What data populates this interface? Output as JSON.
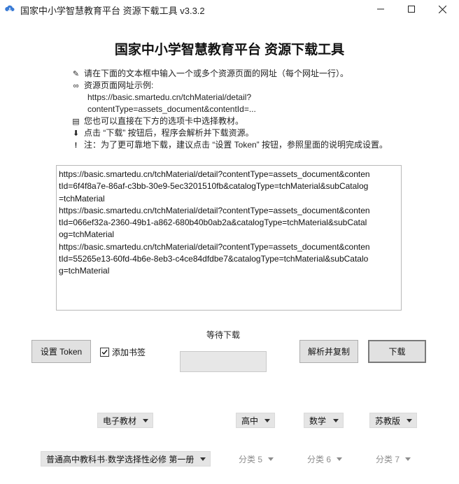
{
  "window": {
    "title": "国家中小学智慧教育平台 资源下载工具 v3.3.2",
    "icon": "download-cloud-icon",
    "controls": [
      "minimize-icon",
      "maximize-icon",
      "close-icon"
    ]
  },
  "heading": "国家中小学智慧教育平台 资源下载工具",
  "instructions": [
    {
      "icon": "pin-icon",
      "text": "请在下面的文本框中输入一个或多个资源页面的网址（每个网址一行）。"
    },
    {
      "icon": "link-icon",
      "text": "资源页面网址示例:"
    },
    {
      "icon": "",
      "text": "https://basic.smartedu.cn/tchMaterial/detail?"
    },
    {
      "icon": "",
      "text": "contentType=assets_document&contentId=..."
    },
    {
      "icon": "memo-icon",
      "text": "您也可以直接在下方的选项卡中选择教材。"
    },
    {
      "icon": "inbox-icon",
      "text": "点击 “下载” 按钮后，程序会解析并下载资源。"
    },
    {
      "icon": "exclamation-icon",
      "text": "注：为了更可靠地下载，建议点击 “设置 Token” 按钮，参照里面的说明完成设置。"
    }
  ],
  "url_input": {
    "lines": [
      "https://basic.smartedu.cn/tchMaterial/detail?contentType=assets_document&conten",
      "tId=6f4f8a7e-86af-c3bb-30e9-5ec3201510fb&catalogType=tchMaterial&subCatalog",
      "=tchMaterial",
      "https://basic.smartedu.cn/tchMaterial/detail?contentType=assets_document&conten",
      "tId=066ef32a-2360-49b1-a862-680b40b0ab2a&catalogType=tchMaterial&subCatal",
      "og=tchMaterial",
      "https://basic.smartedu.cn/tchMaterial/detail?contentType=assets_document&conten",
      "tId=55265e13-60fd-4b6e-8eb3-c4ce84dfdbe7&catalogType=tchMaterial&subCatalo",
      "g=tchMaterial"
    ]
  },
  "status": {
    "label": "等待下载",
    "progress": 0
  },
  "buttons": {
    "set_token": "设置 Token",
    "parse_copy": "解析并复制",
    "download": "下载"
  },
  "bookmark": {
    "label": "添加书签",
    "checked": true
  },
  "filters_row1": [
    {
      "value": "电子教材",
      "enabled": true
    },
    {
      "value": "高中",
      "enabled": true
    },
    {
      "value": "数学",
      "enabled": true
    },
    {
      "value": "苏教版",
      "enabled": true
    }
  ],
  "filters_row2": [
    {
      "value": "普通高中教科书·数学选择性必修 第一册",
      "enabled": true
    },
    {
      "value": "分类 5",
      "enabled": false
    },
    {
      "value": "分类 6",
      "enabled": false
    },
    {
      "value": "分类 7",
      "enabled": false
    }
  ]
}
